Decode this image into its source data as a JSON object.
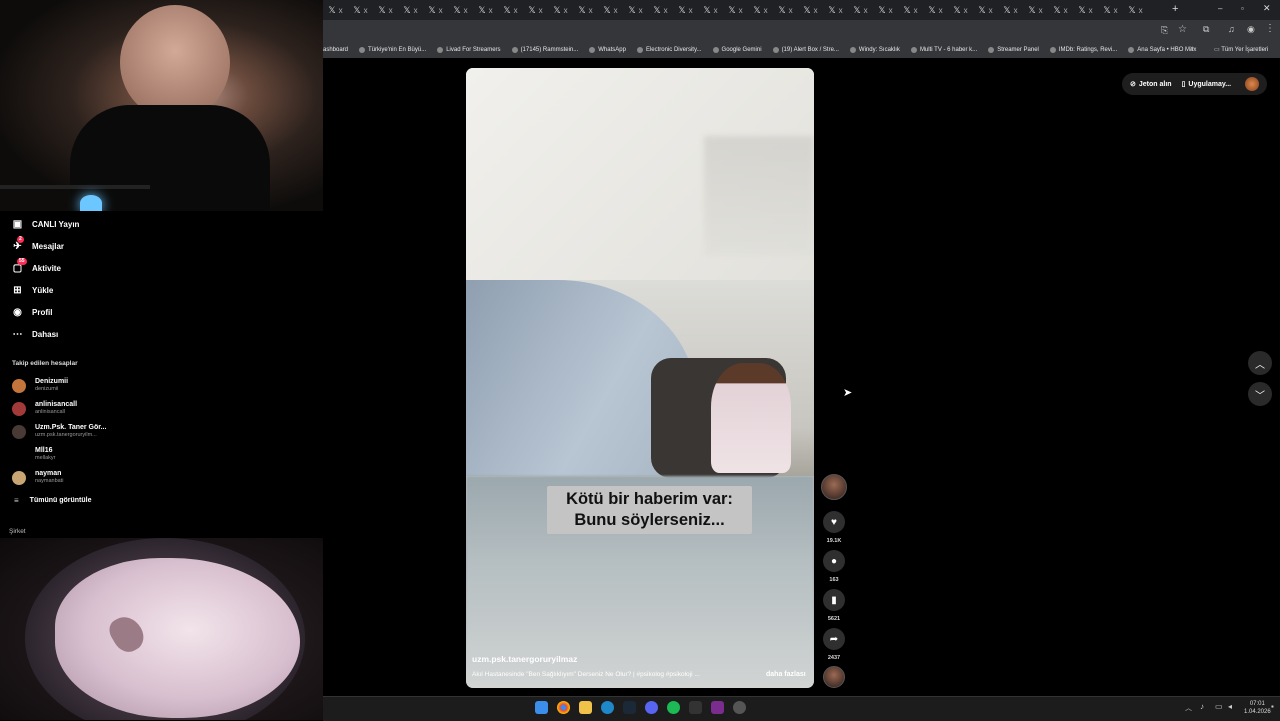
{
  "browser": {
    "tab_glyph": "𝕏",
    "tab_close": "x",
    "tab_count": 33,
    "bookmarks": [
      "ashboard",
      "Türkiye'nin En Büyü...",
      "Livad For Streamers",
      "(17145) Rammstein...",
      "WhatsApp",
      "Electronic Diversity...",
      "Google Gemini",
      "(19) Alert Box / Stre...",
      "Windy: Sıcaklık",
      "Multi TV - 6 haber k...",
      "Streamer Panel",
      "IMDb: Ratings, Revi...",
      "Ana Sayfa • HBO Max"
    ],
    "bookmarks_more": "»",
    "all_bookmarks": "Tüm Yer İşaretleri"
  },
  "nav": {
    "items": [
      {
        "label": "CANLI Yayın",
        "icon": "live-icon",
        "badge": ""
      },
      {
        "label": "Mesajlar",
        "icon": "inbox-icon",
        "badge": "2"
      },
      {
        "label": "Aktivite",
        "icon": "activity-icon",
        "badge": "55"
      },
      {
        "label": "Yükle",
        "icon": "upload-icon",
        "badge": ""
      },
      {
        "label": "Profil",
        "icon": "profile-icon",
        "badge": ""
      },
      {
        "label": "Dahası",
        "icon": "more-icon",
        "badge": ""
      }
    ],
    "following_heading": "Takip edilen hesaplar",
    "accounts": [
      {
        "name": "Denizumii",
        "handle": "denizumii"
      },
      {
        "name": "anlinisancall",
        "handle": "anlinisancall"
      },
      {
        "name": "Uzm.Psk. Taner Gör...",
        "handle": "uzm.psk.tanergoruryilm..."
      },
      {
        "name": "Mll16",
        "handle": "mellakyr"
      },
      {
        "name": "nayman",
        "handle": "naymanbati"
      }
    ],
    "see_all": "Tümünü görüntüle",
    "footer_label": "Şirket"
  },
  "top_right": {
    "coins": "Jeton alın",
    "app": "Uygulamay..."
  },
  "video": {
    "caption_line1": "Kötü bir haberim var:",
    "caption_line2": "Bunu söylerseniz...",
    "username": "uzm.psk.tanergoruryilmaz",
    "description": "Akıl Hastanesinde \"Ben Sağlıklıyım\" Derseniz Ne Olur? | #psikolog #psikoloji ...",
    "more": "daha fazlası"
  },
  "actions": {
    "likes": "19.1K",
    "comments": "163",
    "saves": "5621",
    "shares": "2437"
  },
  "taskbar": {
    "time": "07:01",
    "date": "1.04.2026"
  },
  "colors": {
    "accent": "#fe2c55",
    "bg": "#000000",
    "chrome": "#35363a"
  }
}
